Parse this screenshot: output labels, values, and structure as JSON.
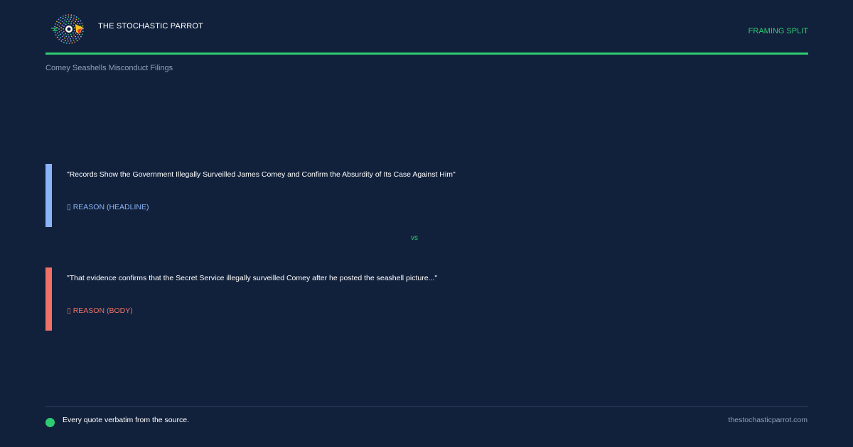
{
  "header": {
    "brand": "THE STOCHASTIC PARROT",
    "tag": "FRAMING SPLIT",
    "logo_icon": "parrot-logo-icon"
  },
  "topic": "Comey Seashells Misconduct Filings",
  "quotes": [
    {
      "text": "\"Records Show the Government Illegally Surveilled James Comey and Confirm the Absurdity of Its Case Against Him\"",
      "source": "▯ REASON (HEADLINE)",
      "color": "#8ab4f8"
    },
    {
      "text": "\"That evidence confirms that the Secret Service illegally surveilled Comey after he posted the seashell picture...\"",
      "source": "▯ REASON (BODY)",
      "color": "#f07167"
    }
  ],
  "divider_label": "vs",
  "footer": {
    "note": "Every quote verbatim from the source.",
    "site": "thestochasticparrot.com"
  },
  "colors": {
    "background": "#12213b",
    "accent": "#2ecc71",
    "muted": "#8fa0b8"
  }
}
